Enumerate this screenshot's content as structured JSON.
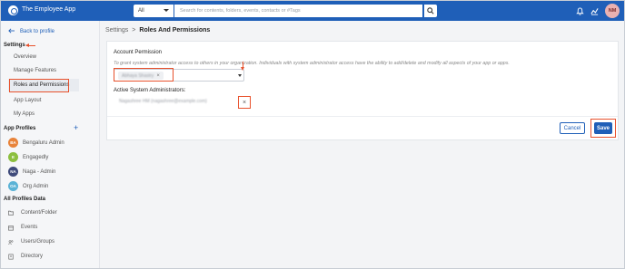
{
  "app": {
    "title": "The Employee App"
  },
  "search": {
    "scope": "All",
    "placeholder": "Search for contents, folders, events, contacts or #Tags"
  },
  "user": {
    "initials": "NM"
  },
  "sidebar": {
    "back_label": "Back to profile",
    "settings_label": "Settings",
    "settings_items": [
      "Overview",
      "Manage Features",
      "Roles and Permissions",
      "App Layout",
      "My Apps"
    ],
    "profiles_label": "App Profiles",
    "profiles": [
      {
        "initials": "BA",
        "name": "Bengaluru Admin",
        "color": "#e8833a"
      },
      {
        "initials": "E",
        "name": "Engagedly",
        "color": "#8cbf3f"
      },
      {
        "initials": "NA",
        "name": "Naga - Admin",
        "color": "#3e4a7a"
      },
      {
        "initials": "OA",
        "name": "Org Admin",
        "color": "#5bb3d6"
      }
    ],
    "data_label": "All Profiles Data",
    "data_items": [
      "Content/Folder",
      "Events",
      "Users/Groups",
      "Directory"
    ]
  },
  "breadcrumb": {
    "parent": "Settings",
    "separator": ">",
    "current": "Roles And Permissions"
  },
  "permission": {
    "title": "Account Permission",
    "description": "To grant system administrator access to others in your organization. Individuals with system administrator access have the ability to add/delete and modify all aspects of your app or apps.",
    "selected_chip": "Abhaya Shastry",
    "active_title": "Active System Administrators:",
    "admin_entry": "Nagashree HM (nagashree@example.com)"
  },
  "actions": {
    "cancel": "Cancel",
    "save": "Save"
  },
  "colors": {
    "brand": "#1f5fb8",
    "highlight": "#e8512c"
  }
}
